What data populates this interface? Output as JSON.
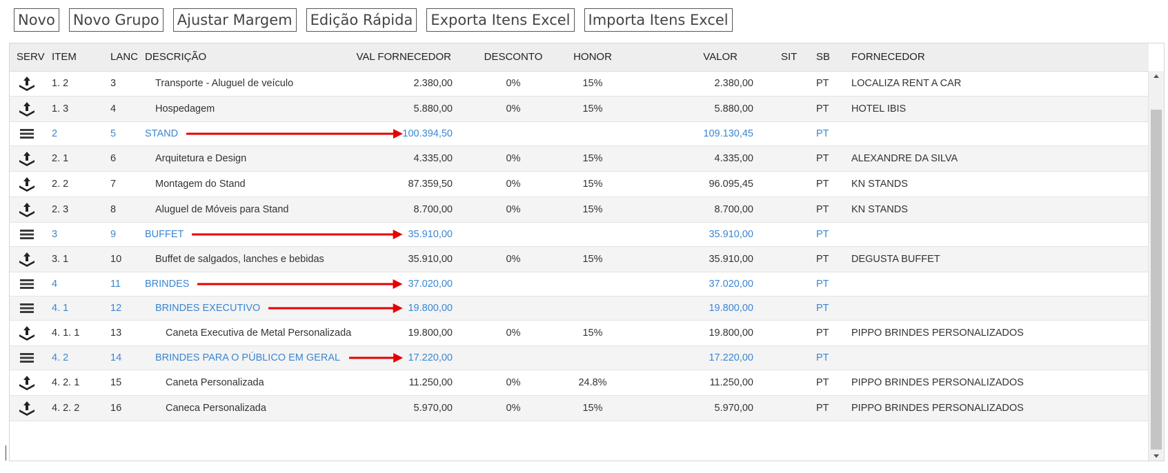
{
  "toolbar": {
    "buttons": [
      "Novo",
      "Novo Grupo",
      "Ajustar Margem",
      "Edição Rápida",
      "Exporta Itens Excel",
      "Importa Itens Excel"
    ]
  },
  "grid": {
    "headers": [
      "SERV",
      "ITEM",
      "LANC",
      "DESCRIÇÃO",
      "VAL FORNECEDOR",
      "DESCONTO",
      "HONOR",
      "VALOR",
      "SIT",
      "SB",
      "FORNECEDOR"
    ],
    "icons": {
      "service": "upload-tray-icon",
      "group": "group-bars-icon"
    },
    "colors": {
      "group_text": "#3a86d1",
      "arrow": "#e60000",
      "header_bg": "#eeeeee"
    },
    "rows": [
      {
        "type": "item",
        "level": 1,
        "icon": "upload-tray-icon",
        "item": "1. 2",
        "lanc": "3",
        "desc": "Transporte - Aluguel de veículo",
        "val_fornecedor": "2.380,00",
        "desconto": "0%",
        "honor": "15%",
        "valor": "2.380,00",
        "sit": "",
        "sb": "PT",
        "fornecedor": "LOCALIZA RENT A CAR"
      },
      {
        "type": "item",
        "level": 1,
        "icon": "upload-tray-icon",
        "item": "1. 3",
        "lanc": "4",
        "desc": "Hospedagem",
        "val_fornecedor": "5.880,00",
        "desconto": "0%",
        "honor": "15%",
        "valor": "5.880,00",
        "sit": "",
        "sb": "PT",
        "fornecedor": "HOTEL IBIS"
      },
      {
        "type": "group",
        "level": 0,
        "icon": "group-bars-icon",
        "item": "2",
        "lanc": "5",
        "desc": "STAND",
        "val_fornecedor": "100.394,50",
        "desconto": "",
        "honor": "",
        "valor": "109.130,45",
        "sit": "",
        "sb": "PT",
        "fornecedor": "",
        "arrow": true
      },
      {
        "type": "item",
        "level": 1,
        "icon": "upload-tray-icon",
        "item": "2. 1",
        "lanc": "6",
        "desc": "Arquitetura e Design",
        "val_fornecedor": "4.335,00",
        "desconto": "0%",
        "honor": "15%",
        "valor": "4.335,00",
        "sit": "",
        "sb": "PT",
        "fornecedor": "ALEXANDRE DA SILVA"
      },
      {
        "type": "item",
        "level": 1,
        "icon": "upload-tray-icon",
        "item": "2. 2",
        "lanc": "7",
        "desc": "Montagem do Stand",
        "val_fornecedor": "87.359,50",
        "desconto": "0%",
        "honor": "15%",
        "valor": "96.095,45",
        "sit": "",
        "sb": "PT",
        "fornecedor": "KN STANDS"
      },
      {
        "type": "item",
        "level": 1,
        "icon": "upload-tray-icon",
        "item": "2. 3",
        "lanc": "8",
        "desc": "Aluguel de Móveis para Stand",
        "val_fornecedor": "8.700,00",
        "desconto": "0%",
        "honor": "15%",
        "valor": "8.700,00",
        "sit": "",
        "sb": "PT",
        "fornecedor": "KN STANDS"
      },
      {
        "type": "group",
        "level": 0,
        "icon": "group-bars-icon",
        "item": "3",
        "lanc": "9",
        "desc": "BUFFET",
        "val_fornecedor": "35.910,00",
        "desconto": "",
        "honor": "",
        "valor": "35.910,00",
        "sit": "",
        "sb": "PT",
        "fornecedor": "",
        "arrow": true
      },
      {
        "type": "item",
        "level": 1,
        "icon": "upload-tray-icon",
        "item": "3. 1",
        "lanc": "10",
        "desc": "Buffet de salgados, lanches e bebidas",
        "val_fornecedor": "35.910,00",
        "desconto": "0%",
        "honor": "15%",
        "valor": "35.910,00",
        "sit": "",
        "sb": "PT",
        "fornecedor": "DEGUSTA BUFFET"
      },
      {
        "type": "group",
        "level": 0,
        "icon": "group-bars-icon",
        "item": "4",
        "lanc": "11",
        "desc": "BRINDES",
        "val_fornecedor": "37.020,00",
        "desconto": "",
        "honor": "",
        "valor": "37.020,00",
        "sit": "",
        "sb": "PT",
        "fornecedor": "",
        "arrow": true
      },
      {
        "type": "group",
        "level": 1,
        "icon": "group-bars-icon",
        "item": "4. 1",
        "lanc": "12",
        "desc": "BRINDES EXECUTIVO",
        "val_fornecedor": "19.800,00",
        "desconto": "",
        "honor": "",
        "valor": "19.800,00",
        "sit": "",
        "sb": "PT",
        "fornecedor": "",
        "arrow": true
      },
      {
        "type": "item",
        "level": 2,
        "icon": "upload-tray-icon",
        "item": "4. 1. 1",
        "lanc": "13",
        "desc": "Caneta Executiva de Metal Personalizada",
        "val_fornecedor": "19.800,00",
        "desconto": "0%",
        "honor": "15%",
        "valor": "19.800,00",
        "sit": "",
        "sb": "PT",
        "fornecedor": "PIPPO BRINDES PERSONALIZADOS"
      },
      {
        "type": "group",
        "level": 1,
        "icon": "group-bars-icon",
        "item": "4. 2",
        "lanc": "14",
        "desc": "BRINDES PARA O PÚBLICO EM GERAL",
        "val_fornecedor": "17.220,00",
        "desconto": "",
        "honor": "",
        "valor": "17.220,00",
        "sit": "",
        "sb": "PT",
        "fornecedor": "",
        "arrow": true
      },
      {
        "type": "item",
        "level": 2,
        "icon": "upload-tray-icon",
        "item": "4. 2. 1",
        "lanc": "15",
        "desc": "Caneta Personalizada",
        "val_fornecedor": "11.250,00",
        "desconto": "0%",
        "honor": "24.8%",
        "valor": "11.250,00",
        "sit": "",
        "sb": "PT",
        "fornecedor": "PIPPO BRINDES PERSONALIZADOS"
      },
      {
        "type": "item",
        "level": 2,
        "icon": "upload-tray-icon",
        "item": "4. 2. 2",
        "lanc": "16",
        "desc": "Caneca Personalizada",
        "val_fornecedor": "5.970,00",
        "desconto": "0%",
        "honor": "15%",
        "valor": "5.970,00",
        "sit": "",
        "sb": "PT",
        "fornecedor": "PIPPO BRINDES PERSONALIZADOS"
      }
    ]
  }
}
